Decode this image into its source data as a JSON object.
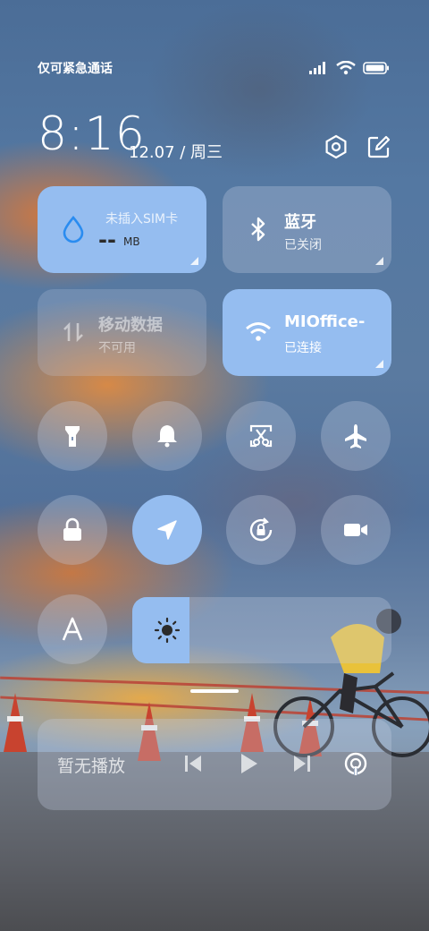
{
  "status_bar": {
    "carrier_text": "仅可紧急通话",
    "icons": [
      "signal-icon",
      "wifi-icon",
      "battery-icon"
    ]
  },
  "header": {
    "time": "8:16",
    "date": "12.07 / 周三",
    "icons": [
      "settings-icon",
      "edit-icon"
    ]
  },
  "tiles": {
    "data_usage": {
      "title": "未插入SIM卡",
      "value": "--",
      "unit": "MB",
      "icon": "water-drop-icon"
    },
    "bluetooth": {
      "title": "蓝牙",
      "status": "已关闭",
      "icon": "bluetooth-icon"
    },
    "mobile_data": {
      "title": "移动数据",
      "status": "不可用",
      "icon": "mobile-data-icon"
    },
    "wifi": {
      "title": "MIOffice-",
      "status": "已连接",
      "icon": "wifi-icon"
    }
  },
  "toggles": [
    {
      "name": "flashlight",
      "icon": "flashlight-icon",
      "on": false
    },
    {
      "name": "ringer",
      "icon": "bell-icon",
      "on": false
    },
    {
      "name": "screenshot",
      "icon": "scissors-icon",
      "on": false
    },
    {
      "name": "airplane-mode",
      "icon": "airplane-icon",
      "on": false
    },
    {
      "name": "lock-screen",
      "icon": "lock-icon",
      "on": false
    },
    {
      "name": "location",
      "icon": "location-arrow-icon",
      "on": true
    },
    {
      "name": "rotation-lock",
      "icon": "rotation-lock-icon",
      "on": false
    },
    {
      "name": "screen-record",
      "icon": "video-camera-icon",
      "on": false
    },
    {
      "name": "auto-text",
      "icon": "font-a-icon",
      "on": false
    }
  ],
  "brightness": {
    "level": 0.22,
    "icon": "sun-icon"
  },
  "media": {
    "label": "暂无播放",
    "controls": [
      "previous-icon",
      "play-icon",
      "next-icon",
      "cast-icon"
    ]
  },
  "colors": {
    "accent": "#95bdf0",
    "tile_inactive": "rgba(200,210,230,0.30)"
  }
}
